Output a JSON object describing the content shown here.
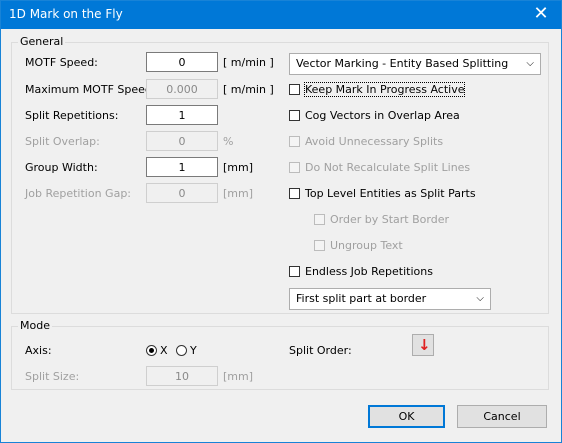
{
  "window": {
    "title": "1D Mark on the Fly",
    "close_glyph": "✕"
  },
  "general": {
    "label": "General",
    "motf_speed": {
      "label": "MOTF Speed:",
      "value": "0",
      "unit": "[ m/min ]"
    },
    "max_motf_speed": {
      "label": "Maximum MOTF Speed:",
      "value": "0.000",
      "unit": "[ m/min ]"
    },
    "split_repetitions": {
      "label": "Split Repetitions:",
      "value": "1"
    },
    "split_overlap": {
      "label": "Split Overlap:",
      "value": "0",
      "unit": "%"
    },
    "group_width": {
      "label": "Group Width:",
      "value": "1",
      "unit": "[mm]"
    },
    "job_repetition_gap": {
      "label": "Job Repetition Gap:",
      "value": "0",
      "unit": "[mm]"
    },
    "marking_mode": {
      "selected": "Vector Marking - Entity Based Splitting"
    },
    "checkboxes": {
      "keep_mark": "Keep Mark In Progress Active",
      "cog_vectors": "Cog Vectors in Overlap Area",
      "avoid_splits": "Avoid Unnecessary Splits",
      "no_recalc": "Do Not Recalculate Split Lines",
      "top_level": "Top Level Entities as Split Parts",
      "order_start": "Order by Start Border",
      "ungroup_text": "Ungroup Text",
      "endless_job": "Endless Job Repetitions"
    },
    "split_part_mode": {
      "selected": "First split part at border"
    }
  },
  "mode": {
    "label": "Mode",
    "axis_label": "Axis:",
    "axis_x": "X",
    "axis_y": "Y",
    "selected_axis": "X",
    "split_order_label": "Split Order:",
    "split_order_glyph": "↓",
    "split_size": {
      "label": "Split Size:",
      "value": "10",
      "unit": "[mm]"
    }
  },
  "buttons": {
    "ok": "OK",
    "cancel": "Cancel"
  },
  "colors": {
    "titlebar": "#0078d7",
    "split_order_arrow": "#e02020"
  }
}
